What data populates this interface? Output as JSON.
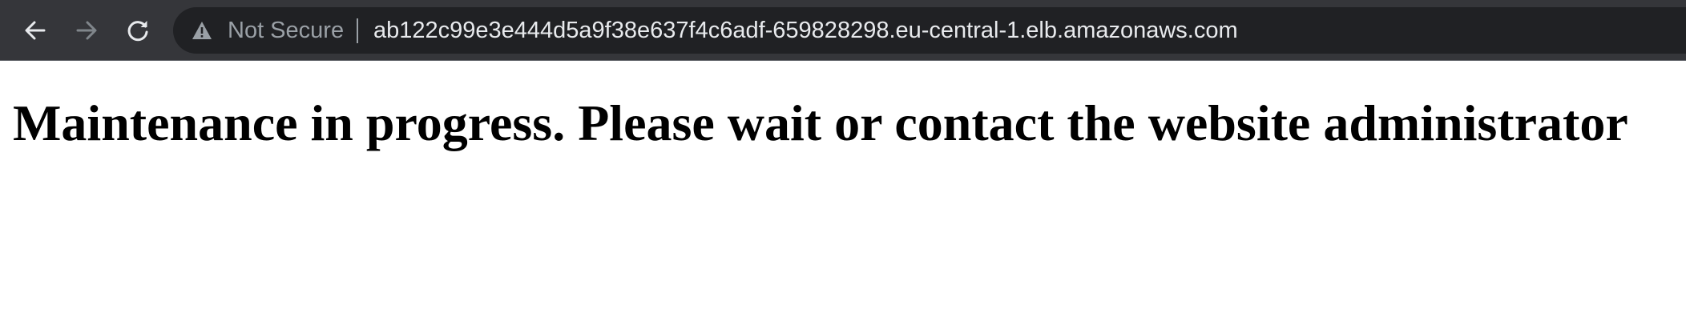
{
  "browser": {
    "security_label": "Not Secure",
    "url": "ab122c99e3e444d5a9f38e637f4c6adf-659828298.eu-central-1.elb.amazonaws.com",
    "icons": {
      "back": "arrow-left-icon",
      "forward": "arrow-right-icon",
      "reload": "reload-icon",
      "security": "warning-triangle-icon"
    },
    "colors": {
      "toolbar": "#35363a",
      "omnibox": "#202124",
      "url_text": "#e8eaed",
      "security_text": "#9aa0a6"
    }
  },
  "page": {
    "heading": "Maintenance in progress. Please wait or contact the website administrator"
  }
}
